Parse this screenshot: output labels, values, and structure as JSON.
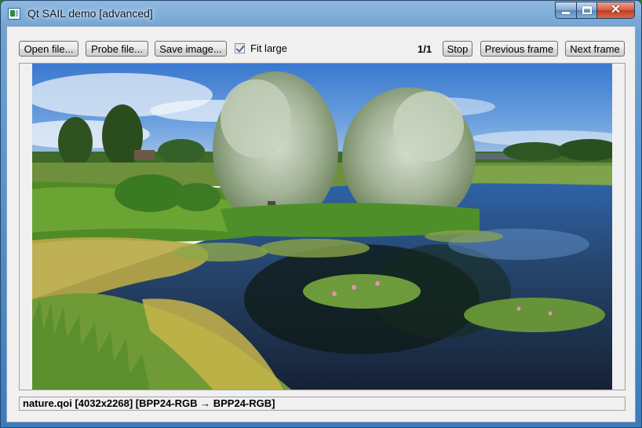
{
  "window": {
    "title": "Qt SAIL demo [advanced]",
    "icon": "app-window-icon"
  },
  "toolbar": {
    "open_label": "Open file...",
    "probe_label": "Probe file...",
    "save_label": "Save image...",
    "fit_large_label": "Fit large",
    "fit_large_checked": true,
    "frame_counter": "1/1",
    "stop_label": "Stop",
    "prev_label": "Previous frame",
    "next_label": "Next frame"
  },
  "image": {
    "description_icon": "nature-photo",
    "colors": {
      "sky": "#3f7fd0",
      "trees": "#a9b89c",
      "grass": "#5c9a2a",
      "water": "#1c2a3a",
      "algae": "#c8b64a"
    }
  },
  "status": {
    "text": "nature.qoi  [4032x2268]  [BPP24-RGB → BPP24-RGB]"
  }
}
